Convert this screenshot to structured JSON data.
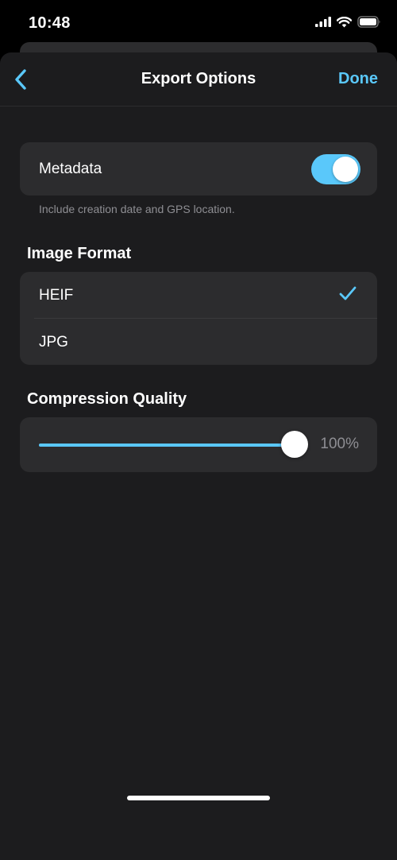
{
  "status_bar": {
    "time": "10:48"
  },
  "nav": {
    "title": "Export Options",
    "done_label": "Done",
    "back_icon": "chevron-left-icon"
  },
  "metadata": {
    "label": "Metadata",
    "enabled": true,
    "footnote": "Include creation date and GPS location."
  },
  "image_format": {
    "header": "Image Format",
    "options": [
      {
        "label": "HEIF",
        "selected": true
      },
      {
        "label": "JPG",
        "selected": false
      }
    ]
  },
  "compression": {
    "header": "Compression Quality",
    "value_label": "100%",
    "value": 1.0
  },
  "colors": {
    "accent": "#5ac8fa",
    "background": "#1c1c1e",
    "card": "#2c2c2e",
    "secondary_text": "#8e8e93"
  }
}
